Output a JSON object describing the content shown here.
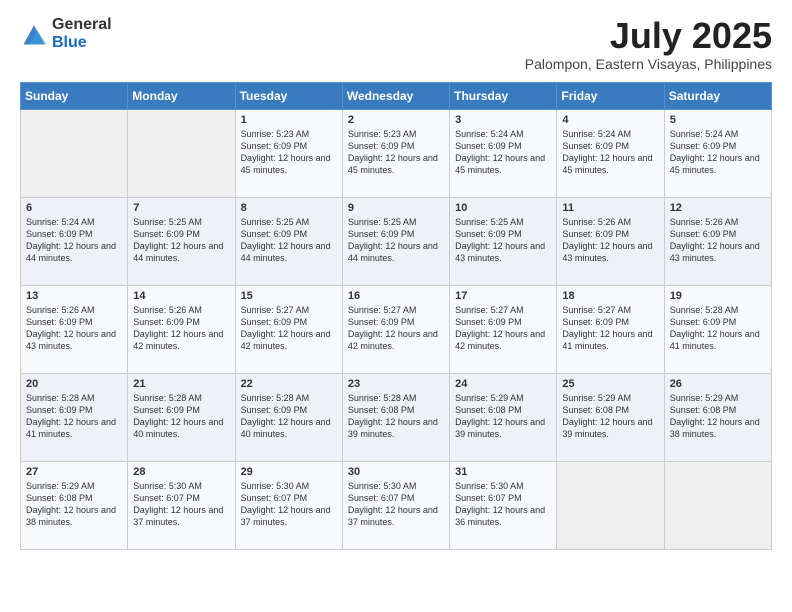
{
  "logo": {
    "general": "General",
    "blue": "Blue"
  },
  "title": {
    "month": "July 2025",
    "location": "Palompon, Eastern Visayas, Philippines"
  },
  "weekdays": [
    "Sunday",
    "Monday",
    "Tuesday",
    "Wednesday",
    "Thursday",
    "Friday",
    "Saturday"
  ],
  "weeks": [
    [
      {
        "day": "",
        "sunrise": "",
        "sunset": "",
        "daylight": ""
      },
      {
        "day": "",
        "sunrise": "",
        "sunset": "",
        "daylight": ""
      },
      {
        "day": "1",
        "sunrise": "Sunrise: 5:23 AM",
        "sunset": "Sunset: 6:09 PM",
        "daylight": "Daylight: 12 hours and 45 minutes."
      },
      {
        "day": "2",
        "sunrise": "Sunrise: 5:23 AM",
        "sunset": "Sunset: 6:09 PM",
        "daylight": "Daylight: 12 hours and 45 minutes."
      },
      {
        "day": "3",
        "sunrise": "Sunrise: 5:24 AM",
        "sunset": "Sunset: 6:09 PM",
        "daylight": "Daylight: 12 hours and 45 minutes."
      },
      {
        "day": "4",
        "sunrise": "Sunrise: 5:24 AM",
        "sunset": "Sunset: 6:09 PM",
        "daylight": "Daylight: 12 hours and 45 minutes."
      },
      {
        "day": "5",
        "sunrise": "Sunrise: 5:24 AM",
        "sunset": "Sunset: 6:09 PM",
        "daylight": "Daylight: 12 hours and 45 minutes."
      }
    ],
    [
      {
        "day": "6",
        "sunrise": "Sunrise: 5:24 AM",
        "sunset": "Sunset: 6:09 PM",
        "daylight": "Daylight: 12 hours and 44 minutes."
      },
      {
        "day": "7",
        "sunrise": "Sunrise: 5:25 AM",
        "sunset": "Sunset: 6:09 PM",
        "daylight": "Daylight: 12 hours and 44 minutes."
      },
      {
        "day": "8",
        "sunrise": "Sunrise: 5:25 AM",
        "sunset": "Sunset: 6:09 PM",
        "daylight": "Daylight: 12 hours and 44 minutes."
      },
      {
        "day": "9",
        "sunrise": "Sunrise: 5:25 AM",
        "sunset": "Sunset: 6:09 PM",
        "daylight": "Daylight: 12 hours and 44 minutes."
      },
      {
        "day": "10",
        "sunrise": "Sunrise: 5:25 AM",
        "sunset": "Sunset: 6:09 PM",
        "daylight": "Daylight: 12 hours and 43 minutes."
      },
      {
        "day": "11",
        "sunrise": "Sunrise: 5:26 AM",
        "sunset": "Sunset: 6:09 PM",
        "daylight": "Daylight: 12 hours and 43 minutes."
      },
      {
        "day": "12",
        "sunrise": "Sunrise: 5:26 AM",
        "sunset": "Sunset: 6:09 PM",
        "daylight": "Daylight: 12 hours and 43 minutes."
      }
    ],
    [
      {
        "day": "13",
        "sunrise": "Sunrise: 5:26 AM",
        "sunset": "Sunset: 6:09 PM",
        "daylight": "Daylight: 12 hours and 43 minutes."
      },
      {
        "day": "14",
        "sunrise": "Sunrise: 5:26 AM",
        "sunset": "Sunset: 6:09 PM",
        "daylight": "Daylight: 12 hours and 42 minutes."
      },
      {
        "day": "15",
        "sunrise": "Sunrise: 5:27 AM",
        "sunset": "Sunset: 6:09 PM",
        "daylight": "Daylight: 12 hours and 42 minutes."
      },
      {
        "day": "16",
        "sunrise": "Sunrise: 5:27 AM",
        "sunset": "Sunset: 6:09 PM",
        "daylight": "Daylight: 12 hours and 42 minutes."
      },
      {
        "day": "17",
        "sunrise": "Sunrise: 5:27 AM",
        "sunset": "Sunset: 6:09 PM",
        "daylight": "Daylight: 12 hours and 42 minutes."
      },
      {
        "day": "18",
        "sunrise": "Sunrise: 5:27 AM",
        "sunset": "Sunset: 6:09 PM",
        "daylight": "Daylight: 12 hours and 41 minutes."
      },
      {
        "day": "19",
        "sunrise": "Sunrise: 5:28 AM",
        "sunset": "Sunset: 6:09 PM",
        "daylight": "Daylight: 12 hours and 41 minutes."
      }
    ],
    [
      {
        "day": "20",
        "sunrise": "Sunrise: 5:28 AM",
        "sunset": "Sunset: 6:09 PM",
        "daylight": "Daylight: 12 hours and 41 minutes."
      },
      {
        "day": "21",
        "sunrise": "Sunrise: 5:28 AM",
        "sunset": "Sunset: 6:09 PM",
        "daylight": "Daylight: 12 hours and 40 minutes."
      },
      {
        "day": "22",
        "sunrise": "Sunrise: 5:28 AM",
        "sunset": "Sunset: 6:09 PM",
        "daylight": "Daylight: 12 hours and 40 minutes."
      },
      {
        "day": "23",
        "sunrise": "Sunrise: 5:28 AM",
        "sunset": "Sunset: 6:08 PM",
        "daylight": "Daylight: 12 hours and 39 minutes."
      },
      {
        "day": "24",
        "sunrise": "Sunrise: 5:29 AM",
        "sunset": "Sunset: 6:08 PM",
        "daylight": "Daylight: 12 hours and 39 minutes."
      },
      {
        "day": "25",
        "sunrise": "Sunrise: 5:29 AM",
        "sunset": "Sunset: 6:08 PM",
        "daylight": "Daylight: 12 hours and 39 minutes."
      },
      {
        "day": "26",
        "sunrise": "Sunrise: 5:29 AM",
        "sunset": "Sunset: 6:08 PM",
        "daylight": "Daylight: 12 hours and 38 minutes."
      }
    ],
    [
      {
        "day": "27",
        "sunrise": "Sunrise: 5:29 AM",
        "sunset": "Sunset: 6:08 PM",
        "daylight": "Daylight: 12 hours and 38 minutes."
      },
      {
        "day": "28",
        "sunrise": "Sunrise: 5:30 AM",
        "sunset": "Sunset: 6:07 PM",
        "daylight": "Daylight: 12 hours and 37 minutes."
      },
      {
        "day": "29",
        "sunrise": "Sunrise: 5:30 AM",
        "sunset": "Sunset: 6:07 PM",
        "daylight": "Daylight: 12 hours and 37 minutes."
      },
      {
        "day": "30",
        "sunrise": "Sunrise: 5:30 AM",
        "sunset": "Sunset: 6:07 PM",
        "daylight": "Daylight: 12 hours and 37 minutes."
      },
      {
        "day": "31",
        "sunrise": "Sunrise: 5:30 AM",
        "sunset": "Sunset: 6:07 PM",
        "daylight": "Daylight: 12 hours and 36 minutes."
      },
      {
        "day": "",
        "sunrise": "",
        "sunset": "",
        "daylight": ""
      },
      {
        "day": "",
        "sunrise": "",
        "sunset": "",
        "daylight": ""
      }
    ]
  ]
}
